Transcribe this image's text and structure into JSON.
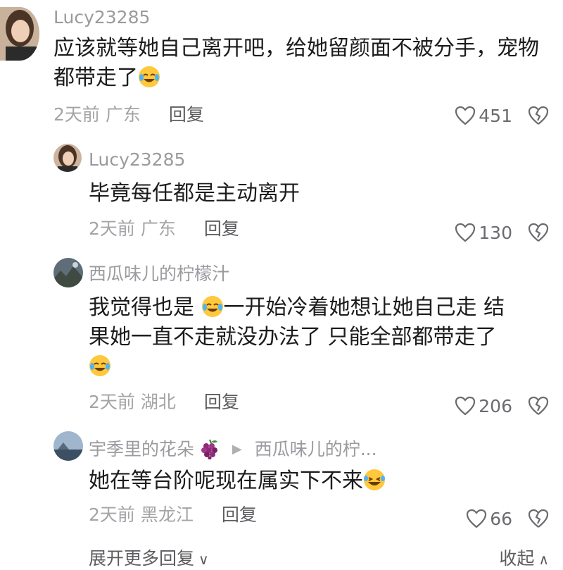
{
  "comments": [
    {
      "username": "Lucy23285",
      "text": "应该就等她自己离开吧，给她留颜面不被分手，宠物都带走了",
      "time": "2天前",
      "location": "广东",
      "reply_label": "回复",
      "likes": "451",
      "avatar_icon": "woman-avatar"
    },
    {
      "username": "Lucy23285",
      "text": "毕竟每任都是主动离开",
      "time": "2天前",
      "location": "广东",
      "reply_label": "回复",
      "likes": "130",
      "avatar_icon": "woman-avatar"
    },
    {
      "username": "西瓜味儿的柠檬汁",
      "text_line1": "我觉得也是",
      "text_line1b": "一开始冷着她想让她自己走 结",
      "text_line2": "果她一直不走就没办法了 只能全部都带走了",
      "time": "2天前",
      "location": "湖北",
      "reply_label": "回复",
      "likes": "206",
      "avatar_icon": "landscape-avatar"
    },
    {
      "username": "宇季里的花朵",
      "reply_to": "西瓜味儿的柠...",
      "text": "她在等台阶呢现在属实下不来",
      "time": "2天前",
      "location": "黑龙江",
      "reply_label": "回复",
      "likes": "66",
      "avatar_icon": "sky-avatar"
    }
  ],
  "footer": {
    "expand_label": "展开更多回复",
    "collapse_label": "收起"
  },
  "icons": {
    "emoji": "laughing-crying-emoji",
    "like": "heart-icon",
    "dislike": "broken-heart-icon",
    "grape": "grape-emoji"
  },
  "colors": {
    "text": "#1c1c1e",
    "muted": "#a4a4a8",
    "username": "#9a9a9f"
  }
}
